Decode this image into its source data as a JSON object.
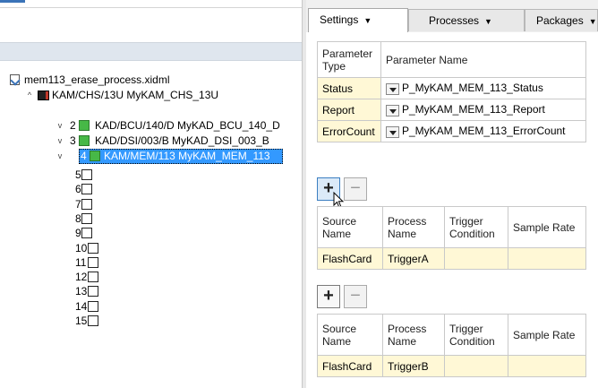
{
  "tree": {
    "root_file": "mem113_erase_process.xidml",
    "chassis": {
      "label": "KAM/CHS/13U  MyKAM_CHS_13U",
      "expander": "^"
    },
    "modules": [
      {
        "slot": "2",
        "label": "KAD/BCU/140/D  MyKAD_BCU_140_D",
        "expander": "v",
        "selected": false
      },
      {
        "slot": "3",
        "label": "KAD/DSI/003/B  MyKAD_DSI_003_B",
        "expander": "v",
        "selected": false
      },
      {
        "slot": "4",
        "label": "KAM/MEM/113  MyKAM_MEM_113",
        "expander": "v",
        "selected": true
      }
    ],
    "empty_slots": [
      "5",
      "6",
      "7",
      "8",
      "9",
      "10",
      "11",
      "12",
      "13",
      "14",
      "15"
    ]
  },
  "tabs": [
    {
      "label": "Settings",
      "active": true
    },
    {
      "label": "Processes",
      "active": false
    },
    {
      "label": "Packages",
      "active": false
    }
  ],
  "param_table": {
    "headers": [
      "Parameter Type",
      "Parameter Name"
    ],
    "rows": [
      {
        "type": "Status",
        "name": "P_MyKAM_MEM_113_Status"
      },
      {
        "type": "Report",
        "name": "P_MyKAM_MEM_113_Report"
      },
      {
        "type": "ErrorCount",
        "name": "P_MyKAM_MEM_113_ErrorCount"
      }
    ]
  },
  "buttons": {
    "add": "+",
    "remove": "−"
  },
  "process_tables": [
    {
      "headers": [
        "Source Name",
        "Process Name",
        "Trigger Condition",
        "Sample Rate"
      ],
      "row": {
        "source": "FlashCard",
        "process": "TriggerA",
        "trigger": "",
        "rate": ""
      }
    },
    {
      "headers": [
        "Source Name",
        "Process Name",
        "Trigger Condition",
        "Sample Rate"
      ],
      "row": {
        "source": "FlashCard",
        "process": "TriggerB",
        "trigger": "",
        "rate": ""
      }
    }
  ],
  "colors": {
    "selection": "#3399ff",
    "module_green": "#47b847",
    "cell_yellow": "#fff8d6",
    "accent": "#3a73b8"
  }
}
